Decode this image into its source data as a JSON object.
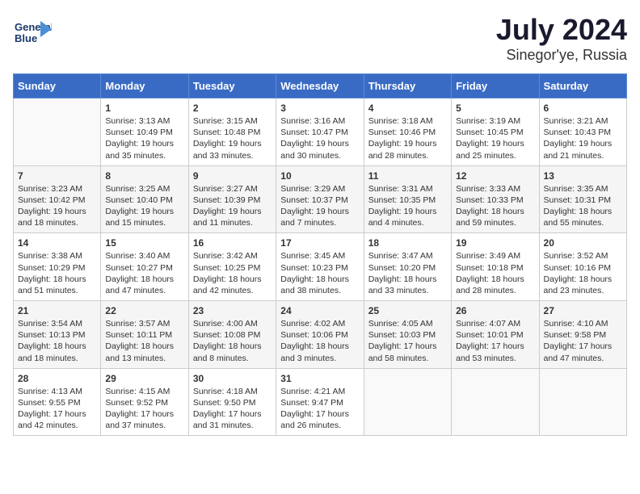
{
  "logo": {
    "line1": "General",
    "line2": "Blue"
  },
  "title": "July 2024",
  "subtitle": "Sinegor'ye, Russia",
  "weekdays": [
    "Sunday",
    "Monday",
    "Tuesday",
    "Wednesday",
    "Thursday",
    "Friday",
    "Saturday"
  ],
  "weeks": [
    [
      {
        "day": "",
        "content": ""
      },
      {
        "day": "1",
        "content": "Sunrise: 3:13 AM\nSunset: 10:49 PM\nDaylight: 19 hours\nand 35 minutes."
      },
      {
        "day": "2",
        "content": "Sunrise: 3:15 AM\nSunset: 10:48 PM\nDaylight: 19 hours\nand 33 minutes."
      },
      {
        "day": "3",
        "content": "Sunrise: 3:16 AM\nSunset: 10:47 PM\nDaylight: 19 hours\nand 30 minutes."
      },
      {
        "day": "4",
        "content": "Sunrise: 3:18 AM\nSunset: 10:46 PM\nDaylight: 19 hours\nand 28 minutes."
      },
      {
        "day": "5",
        "content": "Sunrise: 3:19 AM\nSunset: 10:45 PM\nDaylight: 19 hours\nand 25 minutes."
      },
      {
        "day": "6",
        "content": "Sunrise: 3:21 AM\nSunset: 10:43 PM\nDaylight: 19 hours\nand 21 minutes."
      }
    ],
    [
      {
        "day": "7",
        "content": "Sunrise: 3:23 AM\nSunset: 10:42 PM\nDaylight: 19 hours\nand 18 minutes."
      },
      {
        "day": "8",
        "content": "Sunrise: 3:25 AM\nSunset: 10:40 PM\nDaylight: 19 hours\nand 15 minutes."
      },
      {
        "day": "9",
        "content": "Sunrise: 3:27 AM\nSunset: 10:39 PM\nDaylight: 19 hours\nand 11 minutes."
      },
      {
        "day": "10",
        "content": "Sunrise: 3:29 AM\nSunset: 10:37 PM\nDaylight: 19 hours\nand 7 minutes."
      },
      {
        "day": "11",
        "content": "Sunrise: 3:31 AM\nSunset: 10:35 PM\nDaylight: 19 hours\nand 4 minutes."
      },
      {
        "day": "12",
        "content": "Sunrise: 3:33 AM\nSunset: 10:33 PM\nDaylight: 18 hours\nand 59 minutes."
      },
      {
        "day": "13",
        "content": "Sunrise: 3:35 AM\nSunset: 10:31 PM\nDaylight: 18 hours\nand 55 minutes."
      }
    ],
    [
      {
        "day": "14",
        "content": "Sunrise: 3:38 AM\nSunset: 10:29 PM\nDaylight: 18 hours\nand 51 minutes."
      },
      {
        "day": "15",
        "content": "Sunrise: 3:40 AM\nSunset: 10:27 PM\nDaylight: 18 hours\nand 47 minutes."
      },
      {
        "day": "16",
        "content": "Sunrise: 3:42 AM\nSunset: 10:25 PM\nDaylight: 18 hours\nand 42 minutes."
      },
      {
        "day": "17",
        "content": "Sunrise: 3:45 AM\nSunset: 10:23 PM\nDaylight: 18 hours\nand 38 minutes."
      },
      {
        "day": "18",
        "content": "Sunrise: 3:47 AM\nSunset: 10:20 PM\nDaylight: 18 hours\nand 33 minutes."
      },
      {
        "day": "19",
        "content": "Sunrise: 3:49 AM\nSunset: 10:18 PM\nDaylight: 18 hours\nand 28 minutes."
      },
      {
        "day": "20",
        "content": "Sunrise: 3:52 AM\nSunset: 10:16 PM\nDaylight: 18 hours\nand 23 minutes."
      }
    ],
    [
      {
        "day": "21",
        "content": "Sunrise: 3:54 AM\nSunset: 10:13 PM\nDaylight: 18 hours\nand 18 minutes."
      },
      {
        "day": "22",
        "content": "Sunrise: 3:57 AM\nSunset: 10:11 PM\nDaylight: 18 hours\nand 13 minutes."
      },
      {
        "day": "23",
        "content": "Sunrise: 4:00 AM\nSunset: 10:08 PM\nDaylight: 18 hours\nand 8 minutes."
      },
      {
        "day": "24",
        "content": "Sunrise: 4:02 AM\nSunset: 10:06 PM\nDaylight: 18 hours\nand 3 minutes."
      },
      {
        "day": "25",
        "content": "Sunrise: 4:05 AM\nSunset: 10:03 PM\nDaylight: 17 hours\nand 58 minutes."
      },
      {
        "day": "26",
        "content": "Sunrise: 4:07 AM\nSunset: 10:01 PM\nDaylight: 17 hours\nand 53 minutes."
      },
      {
        "day": "27",
        "content": "Sunrise: 4:10 AM\nSunset: 9:58 PM\nDaylight: 17 hours\nand 47 minutes."
      }
    ],
    [
      {
        "day": "28",
        "content": "Sunrise: 4:13 AM\nSunset: 9:55 PM\nDaylight: 17 hours\nand 42 minutes."
      },
      {
        "day": "29",
        "content": "Sunrise: 4:15 AM\nSunset: 9:52 PM\nDaylight: 17 hours\nand 37 minutes."
      },
      {
        "day": "30",
        "content": "Sunrise: 4:18 AM\nSunset: 9:50 PM\nDaylight: 17 hours\nand 31 minutes."
      },
      {
        "day": "31",
        "content": "Sunrise: 4:21 AM\nSunset: 9:47 PM\nDaylight: 17 hours\nand 26 minutes."
      },
      {
        "day": "",
        "content": ""
      },
      {
        "day": "",
        "content": ""
      },
      {
        "day": "",
        "content": ""
      }
    ]
  ]
}
